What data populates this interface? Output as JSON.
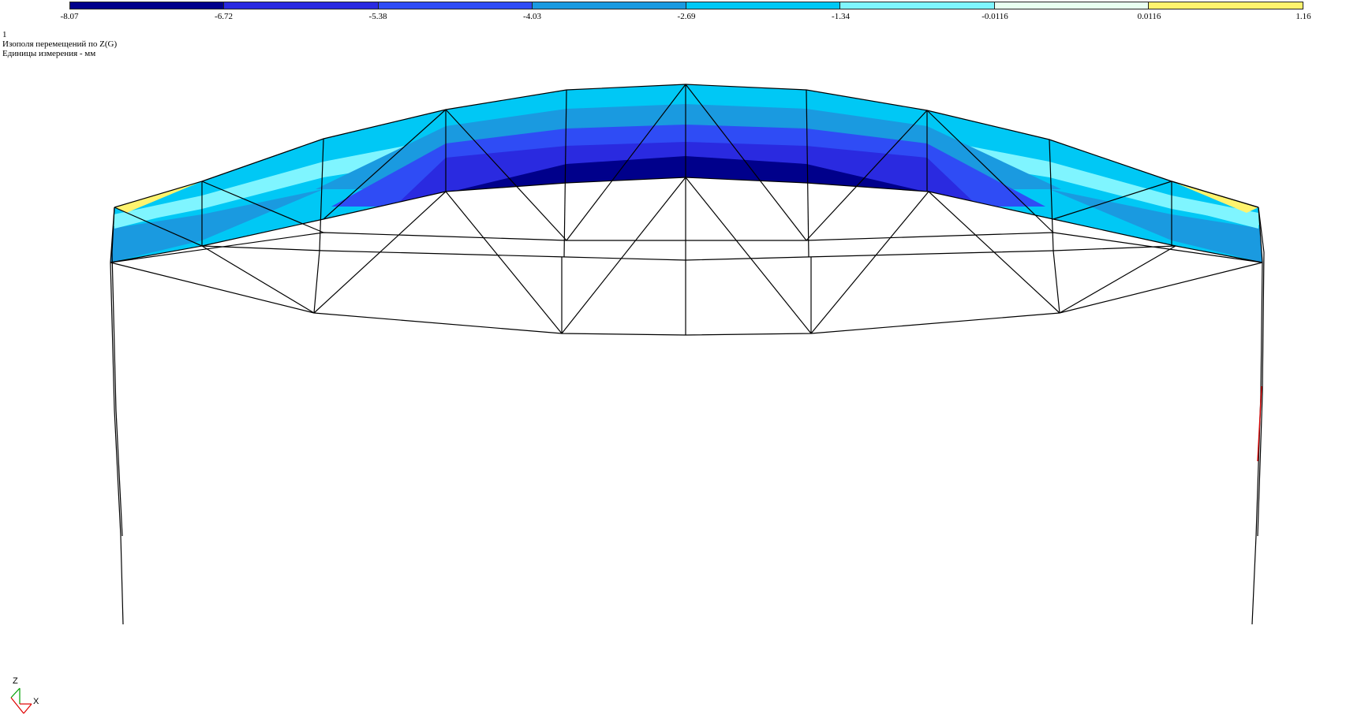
{
  "legend": {
    "colors": [
      "#00008b",
      "#2a2ae0",
      "#2f4cf5",
      "#1a9ae0",
      "#00c8f5",
      "#7ff5ff",
      "#e8fff0",
      "#fff36e"
    ],
    "ticks": [
      "-8.07",
      "-6.72",
      "-5.38",
      "-4.03",
      "-2.69",
      "-1.34",
      "-0.0116",
      "0.0116",
      "1.16"
    ]
  },
  "info": {
    "case_number": "1",
    "title": "Изополя  перемещений по Z(G)",
    "units": "Единицы измерения - мм"
  },
  "axes": {
    "z_label": "Z",
    "x_label": "X",
    "z_color": "#00a000",
    "x_color": "#e00000"
  }
}
